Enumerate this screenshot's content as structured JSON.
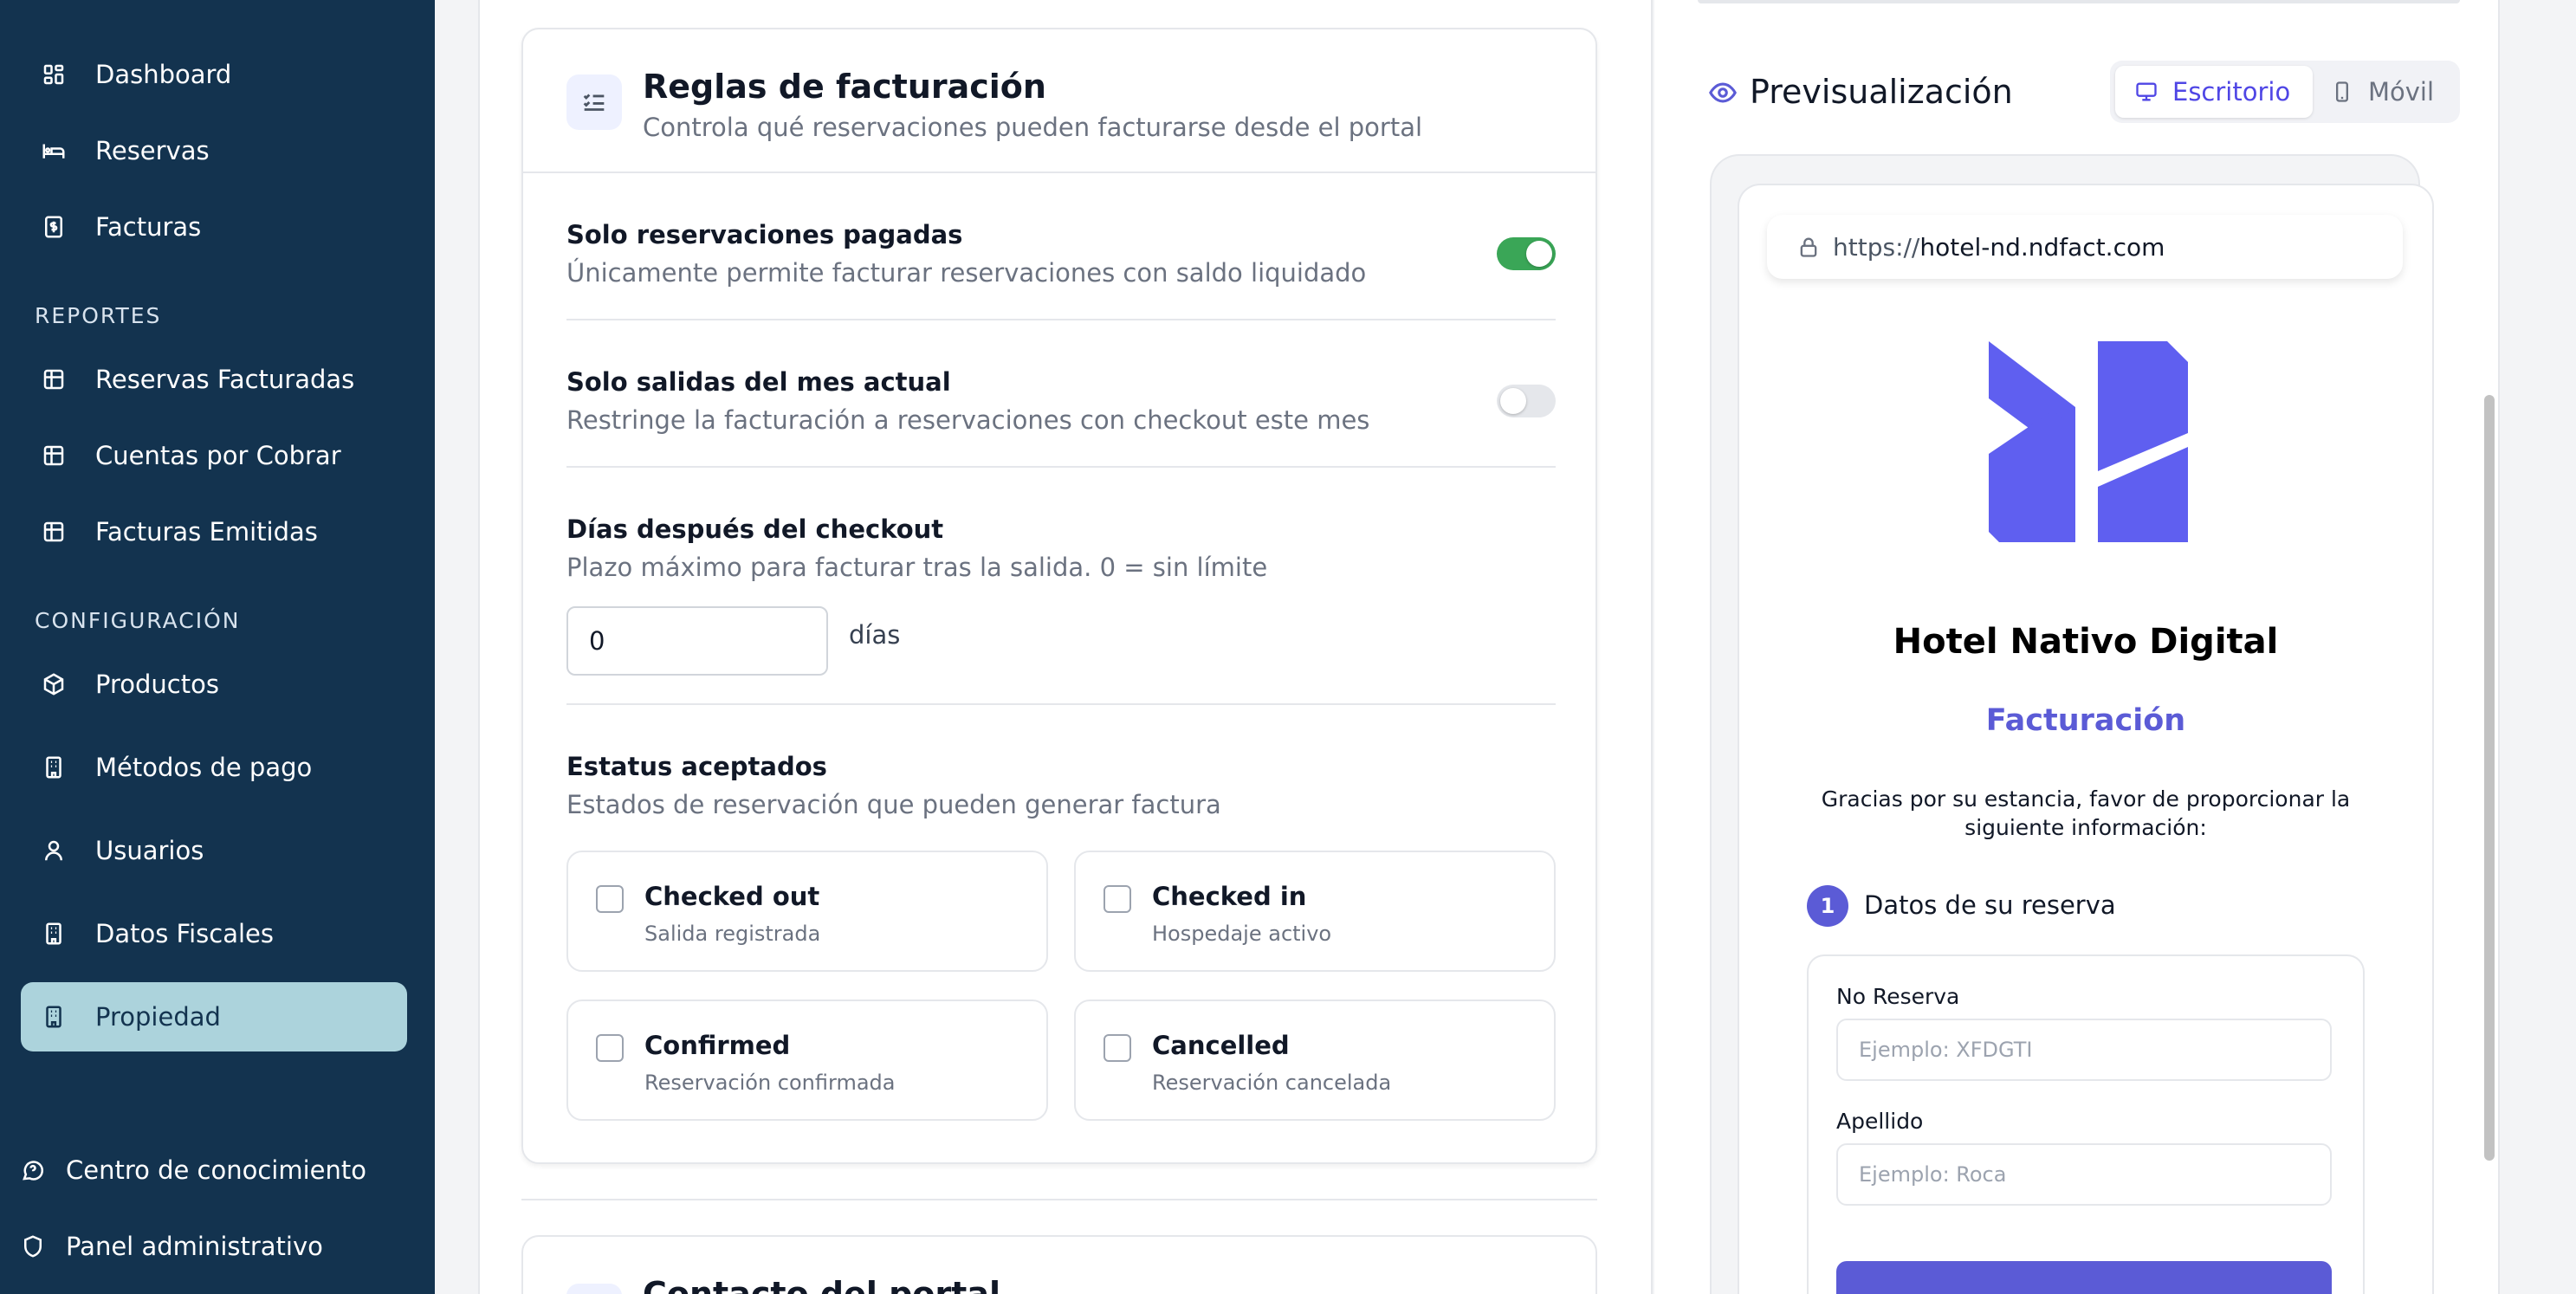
{
  "sidebar": {
    "items": [
      {
        "label": "Dashboard",
        "icon": "dashboard-icon"
      },
      {
        "label": "Reservas",
        "icon": "bed-icon"
      },
      {
        "label": "Facturas",
        "icon": "dollar-receipt-icon"
      }
    ],
    "reports_heading": "REPORTES",
    "reports": [
      {
        "label": "Reservas Facturadas",
        "icon": "table-icon"
      },
      {
        "label": "Cuentas por Cobrar",
        "icon": "table-icon"
      },
      {
        "label": "Facturas Emitidas",
        "icon": "table-icon"
      }
    ],
    "config_heading": "CONFIGURACIÓN",
    "config": [
      {
        "label": "Productos",
        "icon": "package-icon"
      },
      {
        "label": "Métodos de pago",
        "icon": "building-icon"
      },
      {
        "label": "Usuarios",
        "icon": "user-icon"
      },
      {
        "label": "Datos Fiscales",
        "icon": "building-icon"
      },
      {
        "label": "Propiedad",
        "icon": "building-icon",
        "active": true
      }
    ],
    "footer": [
      {
        "label": "Centro de conocimiento",
        "icon": "chat-help-icon"
      },
      {
        "label": "Panel administrativo",
        "icon": "shield-icon"
      }
    ],
    "colors": {
      "background": "#13334f",
      "active_background": "#acd3dc"
    }
  },
  "billing_rules": {
    "title": "Reglas de facturación",
    "subtitle": "Controla qué reservaciones pueden facturarse desde el portal",
    "paid_only": {
      "title": "Solo reservaciones pagadas",
      "description": "Únicamente permite facturar reservaciones con saldo liquidado",
      "enabled": true
    },
    "current_month": {
      "title": "Solo salidas del mes actual",
      "description": "Restringe la facturación a reservaciones con checkout este mes",
      "enabled": false
    },
    "days_after": {
      "title": "Días después del checkout",
      "description": "Plazo máximo para facturar tras la salida. 0 = sin límite",
      "value": "0",
      "unit": "días"
    },
    "statuses": {
      "title": "Estatus aceptados",
      "description": "Estados de reservación que pueden generar factura",
      "options": [
        {
          "label": "Checked out",
          "sub": "Salida registrada",
          "checked": false
        },
        {
          "label": "Checked in",
          "sub": "Hospedaje activo",
          "checked": false
        },
        {
          "label": "Confirmed",
          "sub": "Reservación confirmada",
          "checked": false
        },
        {
          "label": "Cancelled",
          "sub": "Reservación cancelada",
          "checked": false
        }
      ]
    },
    "colors": {
      "toggle_on": "#3aa657",
      "toggle_off": "#e5e7eb"
    }
  },
  "portal_contact": {
    "title": "Contacto del portal"
  },
  "preview": {
    "title": "Previsualización",
    "tabs": [
      {
        "label": "Escritorio",
        "icon": "monitor-icon",
        "active": true
      },
      {
        "label": "Móvil",
        "icon": "smartphone-icon",
        "active": false
      }
    ],
    "url_protocol": "https://",
    "url_host": "hotel-nd.ndfact.com",
    "hotel_name": "Hotel Nativo Digital",
    "section_title": "Facturación",
    "thanks_text": "Gracias por su estancia, favor de proporcionar la siguiente información:",
    "step_number": "1",
    "step_label": "Datos de su reserva",
    "fields": [
      {
        "label": "No Reserva",
        "placeholder": "Ejemplo: XFDGTI"
      },
      {
        "label": "Apellido",
        "placeholder": "Ejemplo: Roca"
      }
    ],
    "accent": "#5b5bd6"
  }
}
